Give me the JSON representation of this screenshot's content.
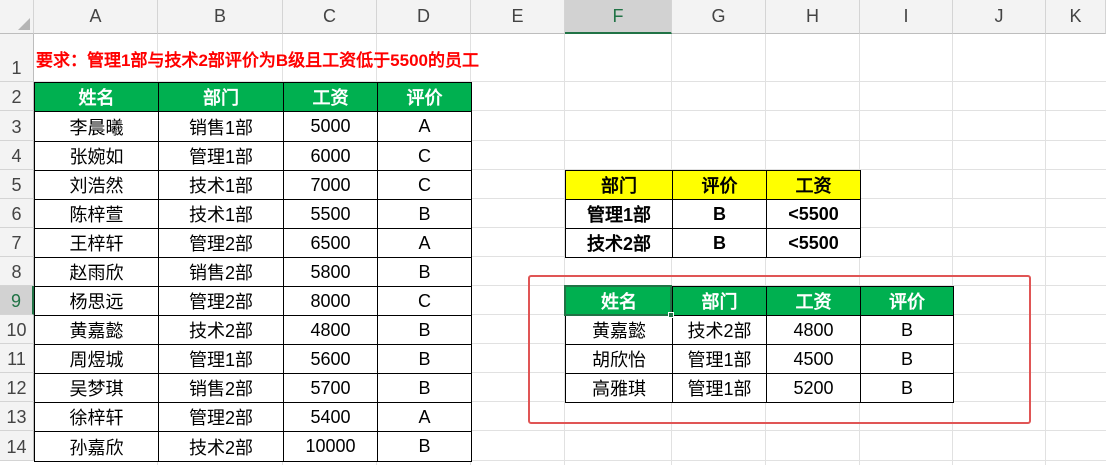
{
  "columns": [
    "A",
    "B",
    "C",
    "D",
    "E",
    "F",
    "G",
    "H",
    "I",
    "J",
    "K"
  ],
  "rows": [
    "1",
    "2",
    "3",
    "4",
    "5",
    "6",
    "7",
    "8",
    "9",
    "10",
    "11",
    "12",
    "13",
    "14"
  ],
  "requirement": "要求：管理1部与技术2部评价为B级且工资低于5500的员工",
  "main_table": {
    "headers": [
      "姓名",
      "部门",
      "工资",
      "评价"
    ],
    "rows": [
      [
        "李晨曦",
        "销售1部",
        "5000",
        "A"
      ],
      [
        "张婉如",
        "管理1部",
        "6000",
        "C"
      ],
      [
        "刘浩然",
        "技术1部",
        "7000",
        "C"
      ],
      [
        "陈梓萱",
        "技术1部",
        "5500",
        "B"
      ],
      [
        "王梓轩",
        "管理2部",
        "6500",
        "A"
      ],
      [
        "赵雨欣",
        "销售2部",
        "5800",
        "B"
      ],
      [
        "杨思远",
        "管理2部",
        "8000",
        "C"
      ],
      [
        "黄嘉懿",
        "技术2部",
        "4800",
        "B"
      ],
      [
        "周煜城",
        "管理1部",
        "5600",
        "B"
      ],
      [
        "吴梦琪",
        "销售2部",
        "5700",
        "B"
      ],
      [
        "徐梓轩",
        "管理2部",
        "5400",
        "A"
      ],
      [
        "孙嘉欣",
        "技术2部",
        "10000",
        "B"
      ]
    ]
  },
  "criteria_table": {
    "headers": [
      "部门",
      "评价",
      "工资"
    ],
    "rows": [
      [
        "管理1部",
        "B",
        "<5500"
      ],
      [
        "技术2部",
        "B",
        "<5500"
      ]
    ]
  },
  "result_table": {
    "headers": [
      "姓名",
      "部门",
      "工资",
      "评价"
    ],
    "rows": [
      [
        "黄嘉懿",
        "技术2部",
        "4800",
        "B"
      ],
      [
        "胡欣怡",
        "管理1部",
        "4500",
        "B"
      ],
      [
        "高雅琪",
        "管理1部",
        "5200",
        "B"
      ]
    ]
  },
  "colors": {
    "header_green": "#00b050",
    "criteria_yellow": "#ffff00",
    "requirement_red": "#ff0000",
    "highlight_box": "#e05555",
    "selection": "#217346"
  },
  "selected_cell": "F9"
}
